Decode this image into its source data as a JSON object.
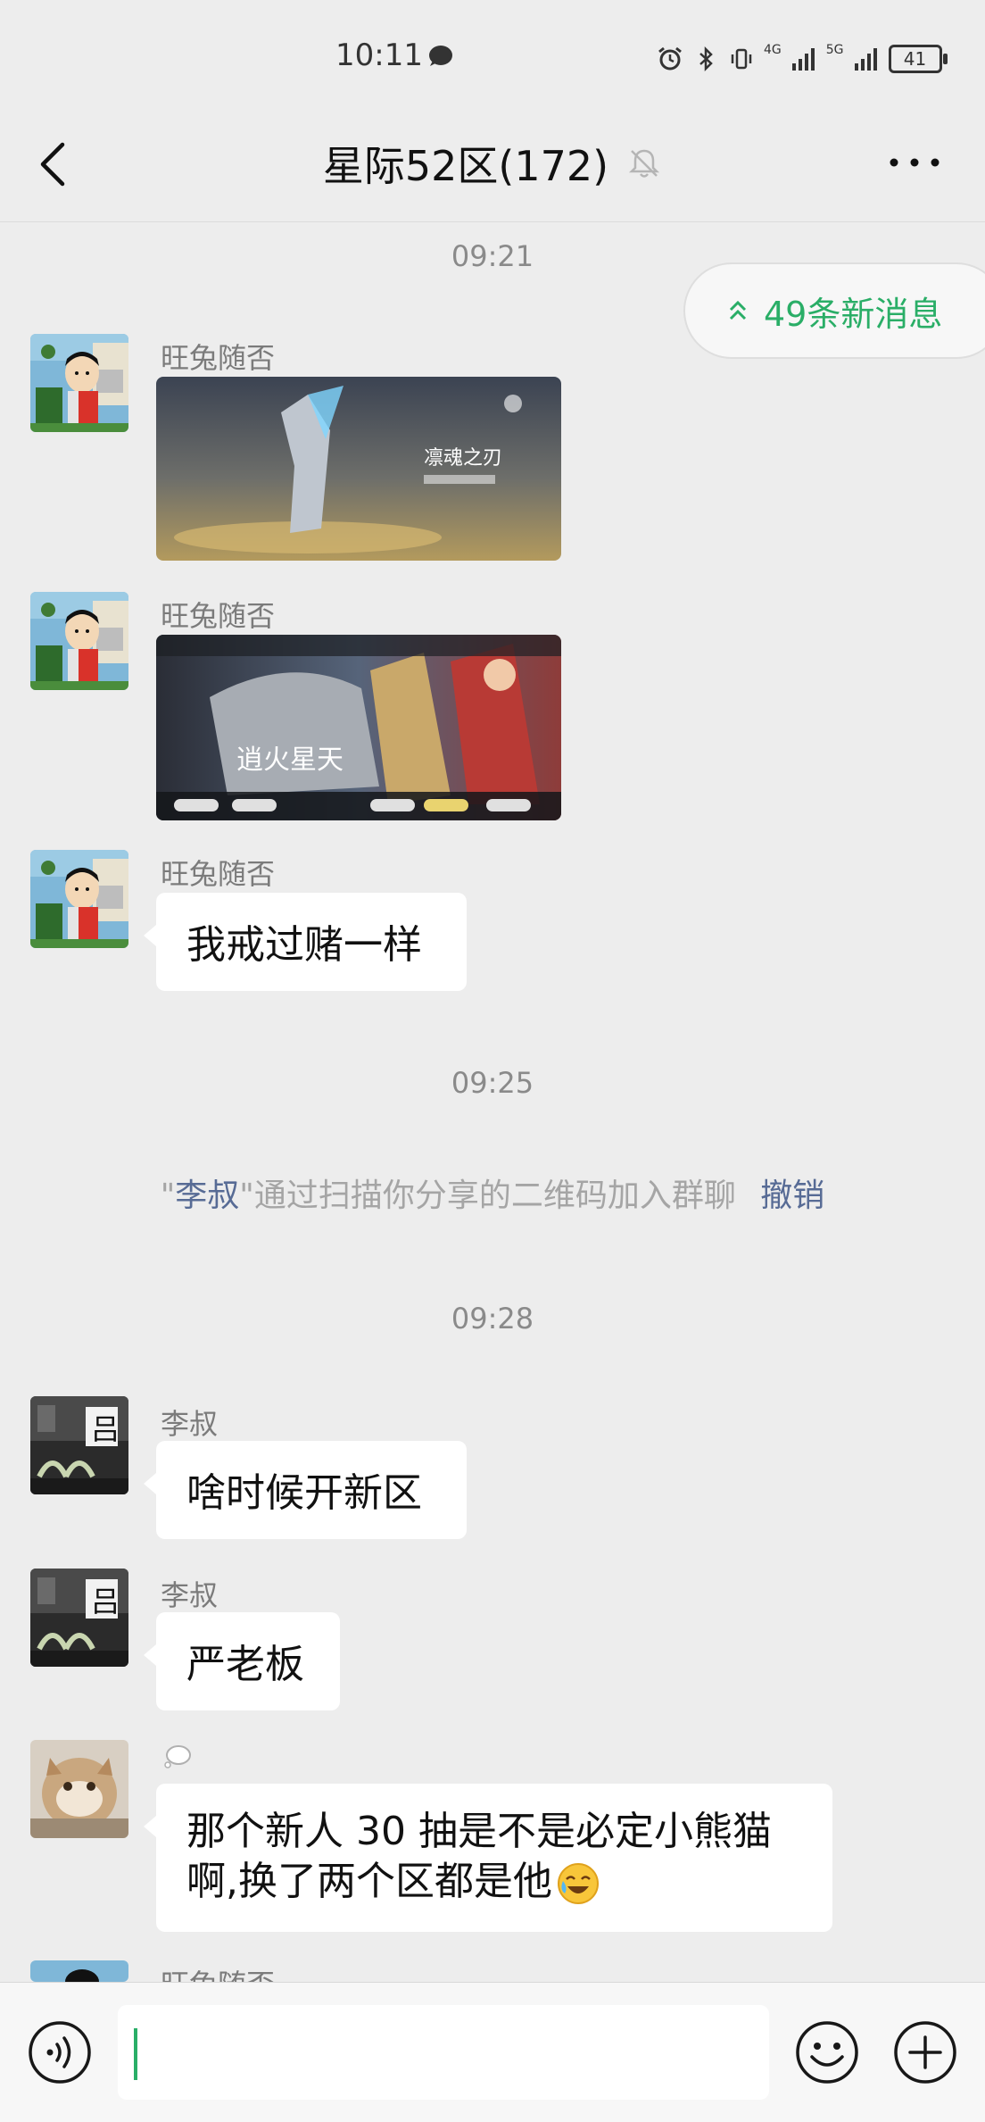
{
  "status_bar": {
    "time": "10:11",
    "battery": "41",
    "network_1": "4G",
    "network_2": "5G"
  },
  "header": {
    "title": "星际52区(172)"
  },
  "new_messages": {
    "label": "49条新消息"
  },
  "timestamps": [
    "09:21",
    "09:25",
    "09:28"
  ],
  "messages": [
    {
      "sender": "旺兔随否",
      "type": "image",
      "caption": "凛魂之刃"
    },
    {
      "sender": "旺兔随否",
      "type": "image",
      "caption": "逍火星天"
    },
    {
      "sender": "旺兔随否",
      "type": "text",
      "text": "我戒过赌一样"
    },
    {
      "sender": "李叔",
      "type": "text",
      "text": "啥时候开新区"
    },
    {
      "sender": "李叔",
      "type": "text",
      "text": "严老板"
    },
    {
      "sender": "",
      "type": "text",
      "line1": "那个新人 30 抽是不是必定小熊猫",
      "line2": "啊,换了两个区都是他"
    },
    {
      "sender": "旺兔随否",
      "type": "partial"
    }
  ],
  "system_notice": {
    "quote_open": "\"",
    "name": "李叔",
    "text": "\"通过扫描你分享的二维码加入群聊",
    "action": "撤销"
  },
  "colors": {
    "background": "#ededed",
    "bubble": "#ffffff",
    "accent_green": "#2aae67",
    "link_blue": "#576b95"
  }
}
